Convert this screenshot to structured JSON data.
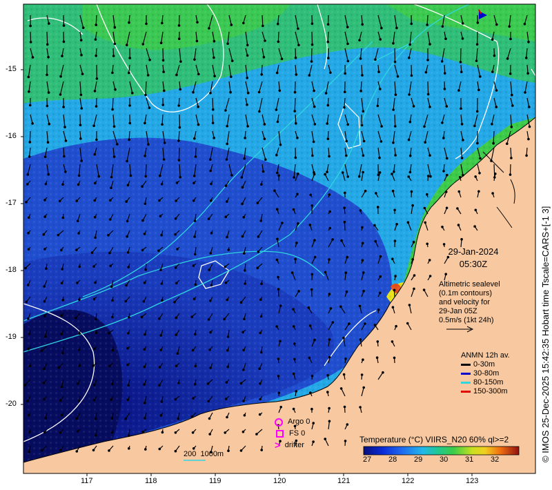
{
  "map": {
    "lat_ticks": [
      "15",
      "16",
      "17",
      "18",
      "19",
      "20"
    ],
    "lon_ticks": [
      "117",
      "118",
      "119",
      "120",
      "121",
      "122",
      "123"
    ],
    "colors": {
      "land": "#f8c9a0",
      "ocean_deep": "#0a1a8a",
      "ocean_mid": "#1f4fd0",
      "ocean_light": "#23a9e8",
      "warm_green": "#3dcc49",
      "warm_yellow": "#e8e31a",
      "hot_red": "#e8501a",
      "contour_white": "#ffffff",
      "contour_cyan": "#2fd6e0"
    }
  },
  "datetime": {
    "date": "29-Jan-2024",
    "time": "05:30Z"
  },
  "notes": [
    "Altimetric sealevel",
    "(0.1m contours)",
    "and velocity for",
    "29-Jan 05Z",
    "0.5m/s (1kt 24h)"
  ],
  "depth_legend": {
    "title": "ANMN 12h av.",
    "items": [
      {
        "label": "0-30m",
        "color": "#000000"
      },
      {
        "label": "30-80m",
        "color": "#0000cc"
      },
      {
        "label": "80-150m",
        "color": "#2fd6e0"
      },
      {
        "label": "150-300m",
        "color": "#e00000"
      }
    ]
  },
  "markers": [
    {
      "label": "Argo 0",
      "icon": "circle-marker",
      "color": "#ff00ff"
    },
    {
      "label": "FS 0",
      "icon": "square-marker",
      "color": "#ff00ff"
    },
    {
      "label": "drifter",
      "icon": "chevron-marker",
      "color": "#ff00ff"
    }
  ],
  "isobath_label": "200  1000m",
  "colorbar": {
    "title": "Temperature (°C) VIIRS_N20 60% ql>=2",
    "ticks": [
      "27",
      "28",
      "29",
      "30",
      "31",
      "32"
    ]
  },
  "credit": "© IMOS 25-Dec-2025 15:42:35 Hobart time Tscale=CARS+[-1 3]"
}
